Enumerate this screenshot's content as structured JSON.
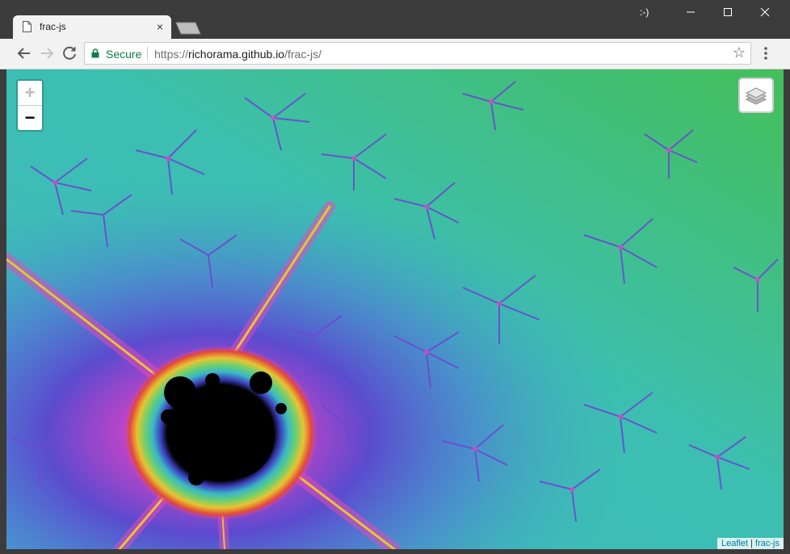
{
  "browser": {
    "tab_title": "frac-js",
    "tab_close": "×",
    "user_label": ":-)",
    "controls": {
      "minimize": "—",
      "maximize": "☐",
      "close": "✕"
    },
    "omnibox": {
      "secure_label": "Secure",
      "url_scheme": "https://",
      "url_host": "richorama.github.io",
      "url_path": "/frac-js/"
    },
    "icons": {
      "back": "back-arrow-icon",
      "forward": "forward-arrow-icon",
      "reload": "reload-icon",
      "lock": "lock-icon",
      "star": "star-icon",
      "menu": "kebab-menu-icon"
    }
  },
  "map": {
    "zoom_in": "+",
    "zoom_out": "−",
    "layers_icon": "layers-icon",
    "attribution": {
      "leaflet": "Leaflet",
      "separator": " | ",
      "source": "frac-js"
    },
    "colors": {
      "teal": "#3ab9b8",
      "green": "#42bf5e",
      "purple": "#5a49cc",
      "magenta": "#d845c4",
      "set": "#000000"
    }
  }
}
